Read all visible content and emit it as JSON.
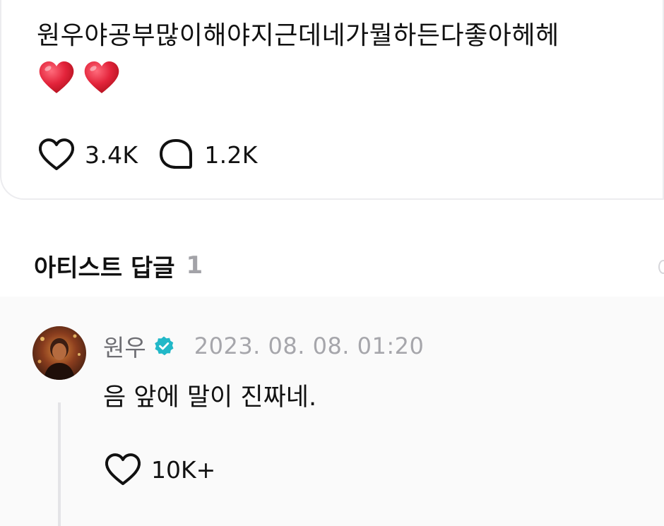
{
  "post": {
    "text": "원우야공부많이해야지근데네가뭘하든다좋아헤헤",
    "emoji": [
      "red-heart",
      "red-heart"
    ],
    "like_count": "3.4K",
    "comment_count": "1.2K"
  },
  "artist_replies": {
    "title": "아티스트 답글",
    "count": "1"
  },
  "reply": {
    "author": "원우",
    "verified": true,
    "timestamp": "2023. 08. 08. 01:20",
    "text": "음 앞에 말이 진짜네.",
    "like_count": "10K+"
  },
  "colors": {
    "verified_badge": "#22b8c8",
    "heart_emoji": "#e3243b",
    "muted_text": "#6e6e73",
    "timestamp_text": "#a6a6ab",
    "count_gray": "#a3a3a8",
    "reply_background": "#fafafa"
  }
}
